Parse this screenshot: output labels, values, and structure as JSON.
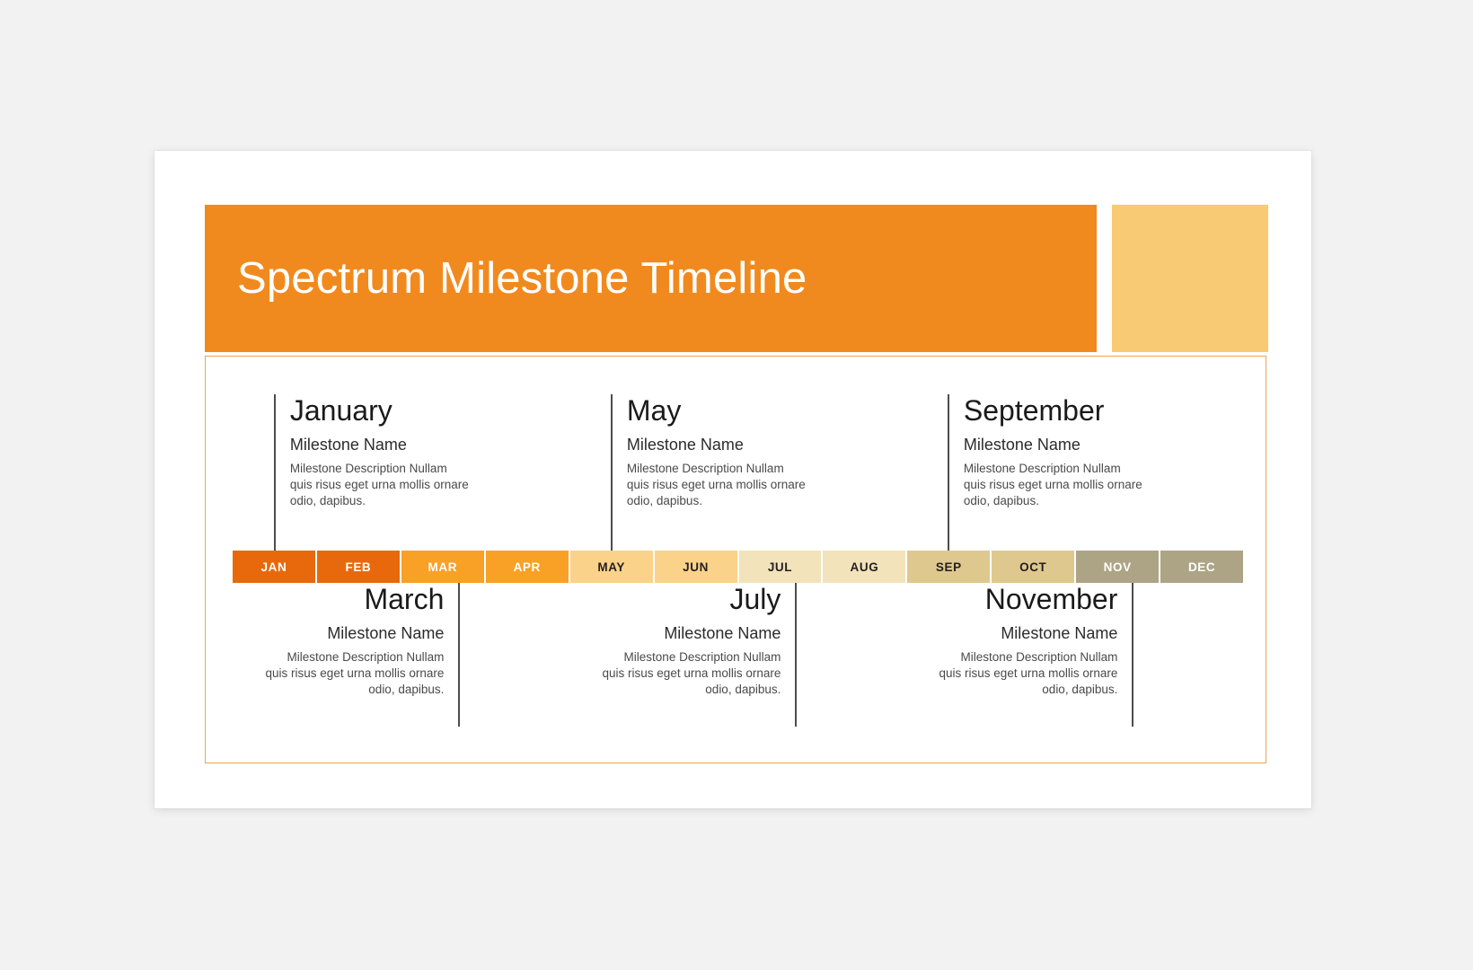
{
  "slide": {
    "title": "Spectrum Milestone Timeline",
    "accent_colors": {
      "header_orange": "#F18A1E",
      "header_yellow": "#F7CA73",
      "panel_border": "#F0A44A",
      "connector_line": "#4d4d4d",
      "page_background": "#f2f2f2",
      "slide_background": "#ffffff"
    }
  },
  "timeline": {
    "months": [
      {
        "label": "JAN",
        "bg": "#E8690B",
        "fg": "#ffffff"
      },
      {
        "label": "FEB",
        "bg": "#E8690B",
        "fg": "#ffffff"
      },
      {
        "label": "MAR",
        "bg": "#F9A026",
        "fg": "#ffffff"
      },
      {
        "label": "APR",
        "bg": "#F9A026",
        "fg": "#ffffff"
      },
      {
        "label": "MAY",
        "bg": "#FBD289",
        "fg": "#231f20"
      },
      {
        "label": "JUN",
        "bg": "#FBD289",
        "fg": "#231f20"
      },
      {
        "label": "JUL",
        "bg": "#F2E3BB",
        "fg": "#231f20"
      },
      {
        "label": "AUG",
        "bg": "#F2E3BB",
        "fg": "#231f20"
      },
      {
        "label": "SEP",
        "bg": "#DFC88E",
        "fg": "#231f20"
      },
      {
        "label": "OCT",
        "bg": "#DFC88E",
        "fg": "#231f20"
      },
      {
        "label": "NOV",
        "bg": "#ADA486",
        "fg": "#ffffff"
      },
      {
        "label": "DEC",
        "bg": "#ADA486",
        "fg": "#ffffff"
      }
    ],
    "milestones": [
      {
        "month": "January",
        "name": "Milestone Name",
        "description": "Milestone Description Nullam quis risus eget urna mollis ornare odio, dapibus.",
        "position": "top",
        "anchor_month_index": 0
      },
      {
        "month": "May",
        "name": "Milestone Name",
        "description": "Milestone Description Nullam quis risus eget urna mollis ornare odio, dapibus.",
        "position": "top",
        "anchor_month_index": 4
      },
      {
        "month": "September",
        "name": "Milestone Name",
        "description": "Milestone Description Nullam quis risus eget urna mollis ornare odio, dapibus.",
        "position": "top",
        "anchor_month_index": 8
      },
      {
        "month": "March",
        "name": "Milestone Name",
        "description": "Milestone Description Nullam quis risus eget urna mollis ornare odio, dapibus.",
        "position": "bottom",
        "anchor_month_index": 2
      },
      {
        "month": "July",
        "name": "Milestone Name",
        "description": "Milestone Description Nullam quis risus eget urna mollis ornare odio, dapibus.",
        "position": "bottom",
        "anchor_month_index": 6
      },
      {
        "month": "November",
        "name": "Milestone Name",
        "description": "Milestone Description Nullam quis risus eget urna mollis ornare odio, dapibus.",
        "position": "bottom",
        "anchor_month_index": 10
      }
    ]
  }
}
